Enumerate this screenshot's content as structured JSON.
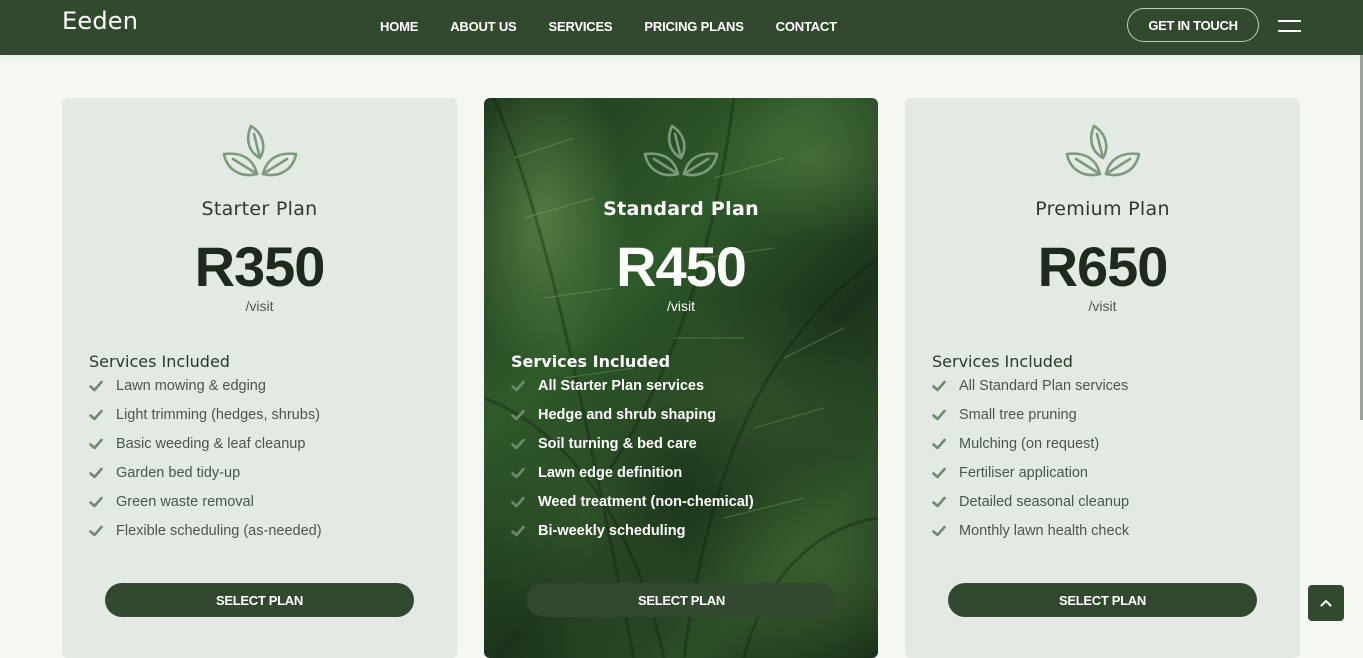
{
  "header": {
    "brand": "Eeden",
    "nav": [
      "HOME",
      "ABOUT US",
      "SERVICES",
      "PRICING PLANS",
      "CONTACT"
    ],
    "cta_label": "GET IN TOUCH",
    "menu_icon": "hamburger-icon"
  },
  "colors": {
    "primary": "#33492f",
    "card_bg": "#e3eae3",
    "icon": "#7d9a7d",
    "check": "#6f8a6f"
  },
  "plans": [
    {
      "name": "Starter Plan",
      "price": "R350",
      "per": "/visit",
      "services_title": "Services Included",
      "features": [
        "Lawn mowing & edging",
        "Light trimming (hedges, shrubs)",
        "Basic weeding & leaf cleanup",
        "Garden bed tidy-up",
        "Green waste removal",
        "Flexible scheduling (as-needed)"
      ],
      "button": "SELECT PLAN"
    },
    {
      "name": "Standard Plan",
      "price": "R450",
      "per": "/visit",
      "services_title": "Services Included",
      "features": [
        "All Starter Plan services",
        "Hedge and shrub shaping",
        "Soil turning & bed care",
        "Lawn edge definition",
        "Weed treatment (non-chemical)",
        "Bi-weekly scheduling"
      ],
      "button": "SELECT PLAN"
    },
    {
      "name": "Premium Plan",
      "price": "R650",
      "per": "/visit",
      "services_title": "Services Included",
      "features": [
        "All Standard Plan services",
        "Small tree pruning",
        "Mulching (on request)",
        "Fertiliser application",
        "Detailed seasonal cleanup",
        "Monthly lawn health check"
      ],
      "button": "SELECT PLAN"
    }
  ],
  "icons": {
    "plan": "leaves-icon",
    "feature": "check-icon",
    "scroll_top": "chevron-up-icon"
  }
}
